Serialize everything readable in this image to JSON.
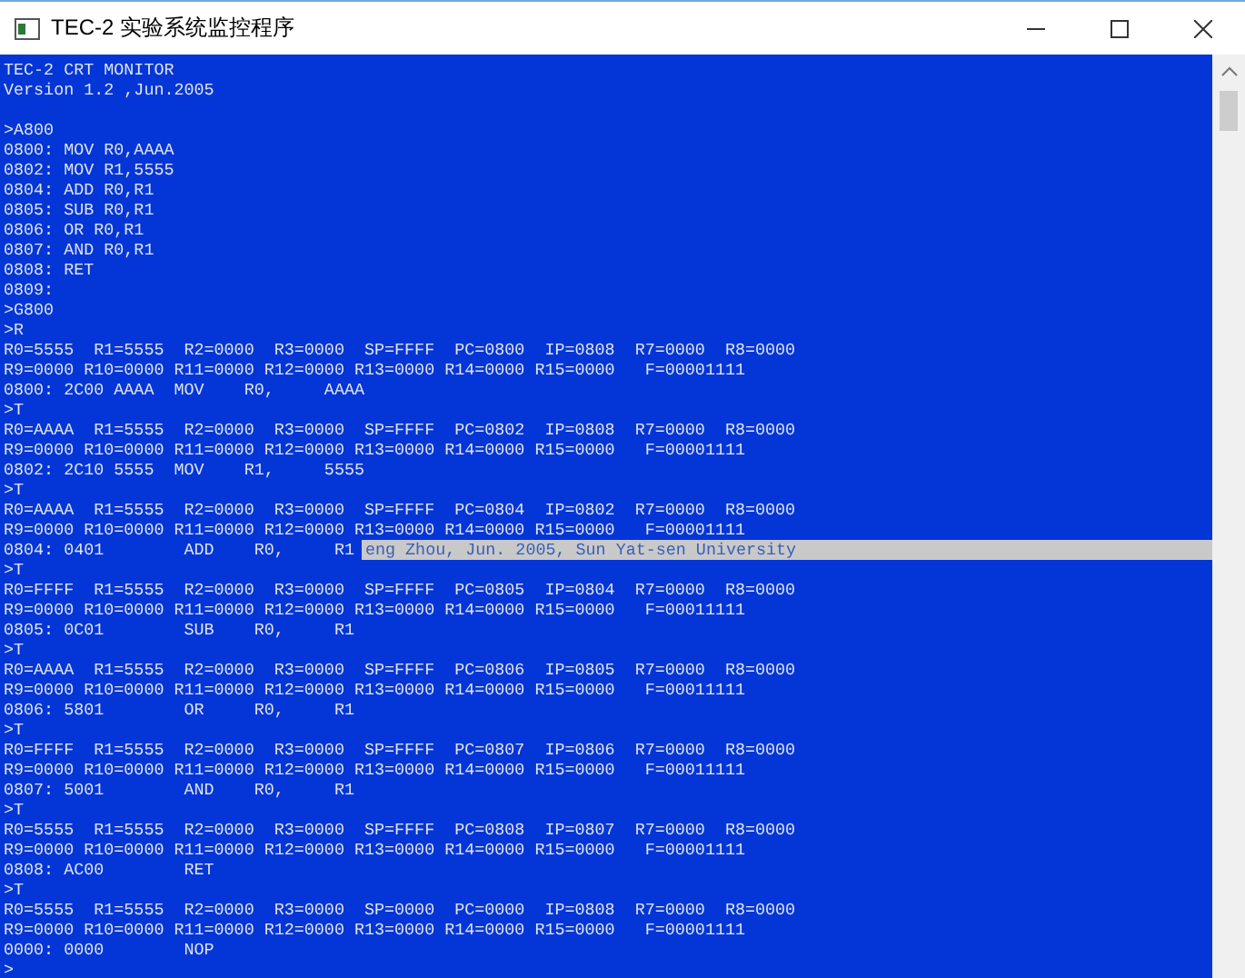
{
  "window": {
    "title": "TEC-2 实验系统监控程序"
  },
  "console": {
    "banner": [
      "TEC-2 CRT MONITOR",
      "Version 1.2 ,Jun.2005"
    ],
    "lines": [
      {
        "text": ">A800"
      },
      {
        "text": "0800: MOV R0,AAAA"
      },
      {
        "text": "0802: MOV R1,5555"
      },
      {
        "text": "0804: ADD R0,R1"
      },
      {
        "text": "0805: SUB R0,R1"
      },
      {
        "text": "0806: OR R0,R1"
      },
      {
        "text": "0807: AND R0,R1"
      },
      {
        "text": "0808: RET"
      },
      {
        "text": "0809:"
      },
      {
        "text": ">G800"
      },
      {
        "text": ">R"
      },
      {
        "text": "R0=5555  R1=5555  R2=0000  R3=0000  SP=FFFF  PC=0800  IP=0808  R7=0000  R8=0000"
      },
      {
        "text": "R9=0000 R10=0000 R11=0000 R12=0000 R13=0000 R14=0000 R15=0000   F=00001111"
      },
      {
        "text": "0800: 2C00 AAAA  MOV    R0,     AAAA"
      },
      {
        "text": ">T"
      },
      {
        "text": "R0=AAAA  R1=5555  R2=0000  R3=0000  SP=FFFF  PC=0802  IP=0808  R7=0000  R8=0000"
      },
      {
        "text": "R9=0000 R10=0000 R11=0000 R12=0000 R13=0000 R14=0000 R15=0000   F=00001111"
      },
      {
        "text": "0802: 2C10 5555  MOV    R1,     5555"
      },
      {
        "text": ">T"
      },
      {
        "text": "R0=AAAA  R1=5555  R2=0000  R3=0000  SP=FFFF  PC=0804  IP=0802  R7=0000  R8=0000"
      },
      {
        "text": "R9=0000 R10=0000 R11=0000 R12=0000 R13=0000 R14=0000 R15=0000   F=00001111"
      },
      {
        "text": "0804: 0401        ADD    R0,     R1",
        "overlay": "eng Zhou, Jun. 2005, Sun Yat-sen University"
      },
      {
        "text": ">T"
      },
      {
        "text": "R0=FFFF  R1=5555  R2=0000  R3=0000  SP=FFFF  PC=0805  IP=0804  R7=0000  R8=0000"
      },
      {
        "text": "R9=0000 R10=0000 R11=0000 R12=0000 R13=0000 R14=0000 R15=0000   F=00011111"
      },
      {
        "text": "0805: 0C01        SUB    R0,     R1"
      },
      {
        "text": ">T"
      },
      {
        "text": "R0=AAAA  R1=5555  R2=0000  R3=0000  SP=FFFF  PC=0806  IP=0805  R7=0000  R8=0000"
      },
      {
        "text": "R9=0000 R10=0000 R11=0000 R12=0000 R13=0000 R14=0000 R15=0000   F=00011111"
      },
      {
        "text": "0806: 5801        OR     R0,     R1"
      },
      {
        "text": ">T"
      },
      {
        "text": "R0=FFFF  R1=5555  R2=0000  R3=0000  SP=FFFF  PC=0807  IP=0806  R7=0000  R8=0000"
      },
      {
        "text": "R9=0000 R10=0000 R11=0000 R12=0000 R13=0000 R14=0000 R15=0000   F=00011111"
      },
      {
        "text": "0807: 5001        AND    R0,     R1"
      },
      {
        "text": ">T"
      },
      {
        "text": "R0=5555  R1=5555  R2=0000  R3=0000  SP=FFFF  PC=0808  IP=0807  R7=0000  R8=0000"
      },
      {
        "text": "R9=0000 R10=0000 R11=0000 R12=0000 R13=0000 R14=0000 R15=0000   F=00001111"
      },
      {
        "text": "0808: AC00        RET"
      },
      {
        "text": ">T"
      },
      {
        "text": "R0=5555  R1=5555  R2=0000  R3=0000  SP=0000  PC=0000  IP=0808  R7=0000  R8=0000"
      },
      {
        "text": "R9=0000 R10=0000 R11=0000 R12=0000 R13=0000 R14=0000 R15=0000   F=00001111"
      },
      {
        "text": "0000: 0000        NOP"
      },
      {
        "text": ">"
      }
    ]
  }
}
